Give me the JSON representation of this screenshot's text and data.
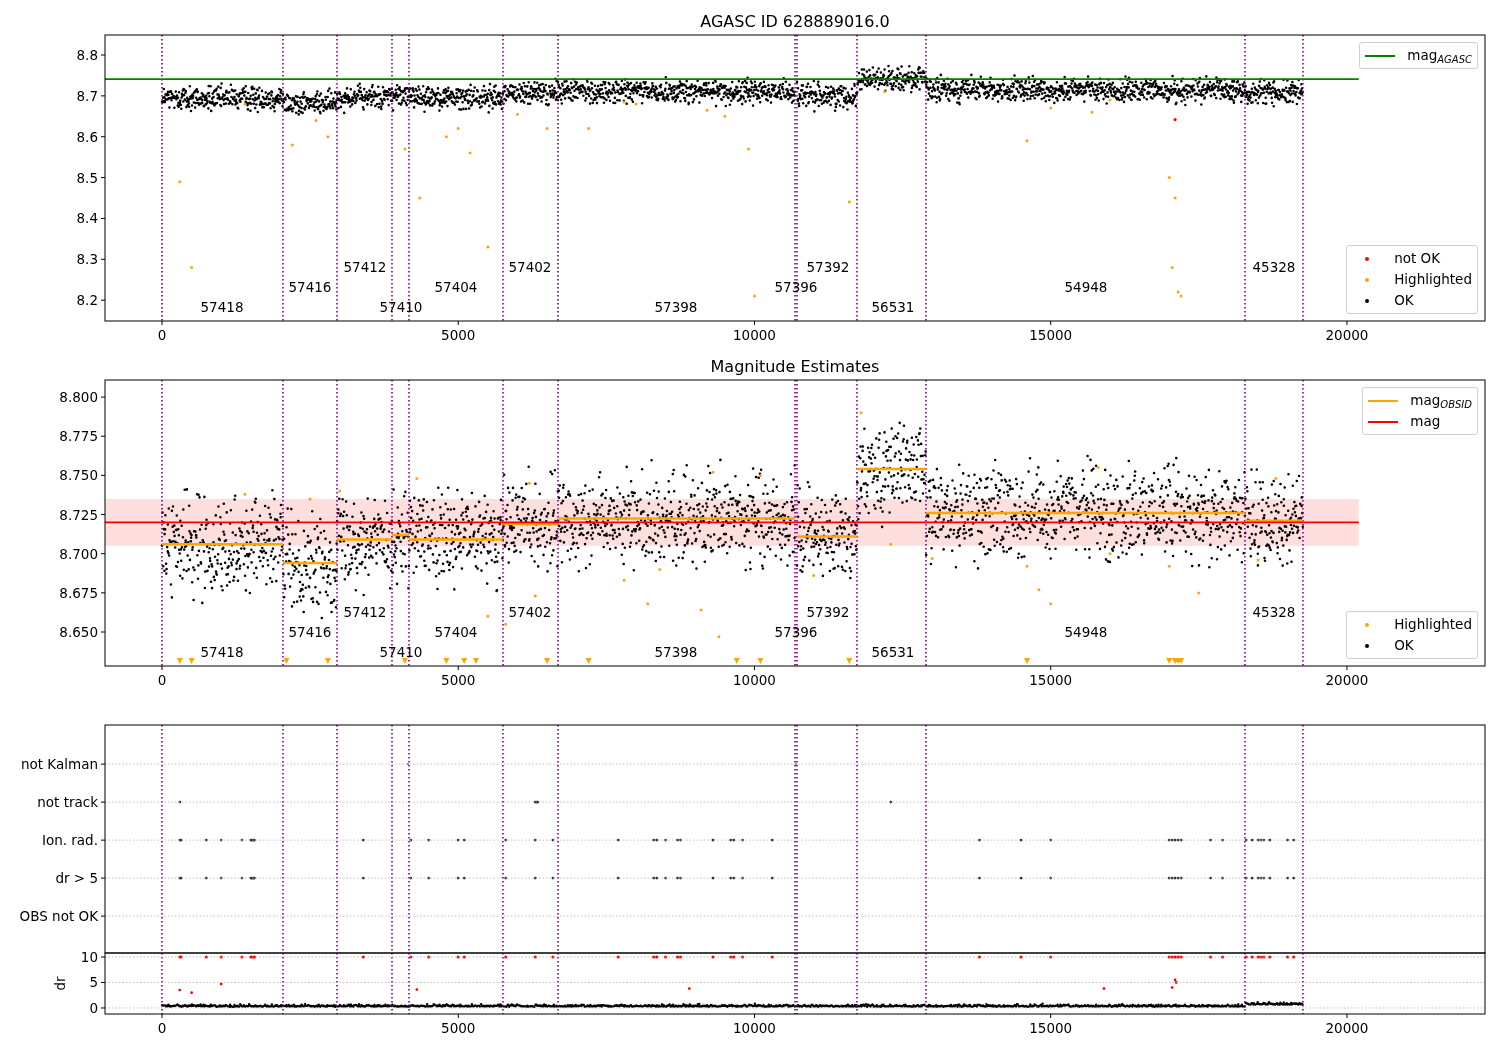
{
  "figure": {
    "panels": [
      {
        "kind": "agasc",
        "chart_data": {
          "type": "line",
          "title": "AGASC ID 628889016.0",
          "x": [
            -962,
            20200
          ],
          "series": [
            {
              "name": "mag$_{AGASC}$",
              "color": "#008000",
              "values": [
                8.741,
                8.741
              ]
            }
          ],
          "xlim": [
            -962,
            22330
          ],
          "ylim": [
            8.149,
            8.849
          ],
          "xticks": [
            0,
            5000,
            10000,
            15000,
            20000
          ],
          "yticks": [
            8.2,
            8.3,
            8.4,
            8.5,
            8.6,
            8.7,
            8.8
          ],
          "annotations": [
            "57418",
            "57416",
            "57412",
            "57410",
            "57404",
            "57402",
            "57398",
            "57396",
            "57392",
            "56531",
            "54948",
            "45328"
          ]
        },
        "marker_legend": [
          {
            "label": "not OK",
            "color": "#ff0000"
          },
          {
            "label": "Highlighted",
            "color": "#ffa500"
          },
          {
            "label": "OK",
            "color": "#000000"
          }
        ]
      },
      {
        "kind": "estimates",
        "chart_data": {
          "type": "line",
          "title": "Magnitude Estimates",
          "x": [
            -962,
            0,
            2042,
            2042,
            2042,
            2954,
            2954,
            2954,
            3882,
            3882,
            3882,
            4169,
            4169,
            4169,
            5755,
            5755,
            5755,
            6684,
            6684,
            6684,
            10684,
            10684,
            10717,
            11730,
            11730,
            11730,
            12894,
            12894,
            12894,
            18278,
            18278,
            18278,
            19257,
            19257,
            20200
          ],
          "series": [
            {
              "name": "mag$_{OBSID}$",
              "color": "#ffa500",
              "values": [
                null,
                8.706,
                8.706,
                null,
                8.694,
                8.694,
                null,
                8.709,
                8.709,
                null,
                8.712,
                8.712,
                null,
                8.709,
                8.709,
                null,
                8.719,
                8.719,
                null,
                8.7225,
                8.7225,
                null,
                8.711,
                8.711,
                null,
                8.754,
                8.754,
                null,
                8.726,
                8.726,
                null,
                8.721,
                8.721,
                null,
                null
              ]
            },
            {
              "name": "mag",
              "color": "#ff0000",
              "values": [
                8.72,
                8.72,
                8.72,
                8.72,
                8.72,
                8.72,
                8.72,
                8.72,
                8.72,
                8.72,
                8.72,
                8.72,
                8.72,
                8.72,
                8.72,
                8.72,
                8.72,
                8.72,
                8.72,
                8.72,
                8.72,
                8.72,
                8.72,
                8.72,
                8.72,
                8.72,
                8.72,
                8.72,
                8.72,
                8.72,
                8.72,
                8.72,
                8.72,
                8.72,
                8.72
              ]
            }
          ],
          "xlim": [
            -962,
            22330
          ],
          "ylim": [
            8.6283,
            8.8109
          ],
          "xticks": [
            0,
            5000,
            10000,
            15000,
            20000
          ],
          "yticks": [
            {
              "value": 8.65,
              "label": "8.650"
            },
            {
              "value": 8.675,
              "label": "8.675"
            },
            {
              "value": 8.7,
              "label": "8.700"
            },
            {
              "value": 8.725,
              "label": "8.725"
            },
            {
              "value": 8.75,
              "label": "8.750"
            },
            {
              "value": 8.775,
              "label": "8.775"
            },
            {
              "value": 8.8,
              "label": "8.800"
            }
          ],
          "annotations": [
            "57418",
            "57416",
            "57412",
            "57410",
            "57404",
            "57402",
            "57398",
            "57396",
            "57392",
            "56531",
            "54948",
            "45328"
          ]
        },
        "marker_legend": [
          {
            "label": "Highlighted",
            "color": "#ffa500"
          },
          {
            "label": "OK",
            "color": "#000000"
          }
        ]
      },
      {
        "kind": "flags",
        "chart_data": {
          "type": "other",
          "categories": [
            "OBS not OK",
            "dr > 5",
            "Ion. rad.",
            "not track",
            "not Kalman"
          ]
        }
      },
      {
        "kind": "dr",
        "chart_data": {
          "type": "scatter",
          "ylabel": "dr",
          "grid": true,
          "xlim": [
            -962,
            22330
          ],
          "ylim": [
            -1.18,
            10.78
          ],
          "xticks": [
            0,
            5000,
            10000,
            15000,
            20000
          ],
          "yticks": [
            0,
            5,
            10
          ]
        }
      }
    ]
  }
}
